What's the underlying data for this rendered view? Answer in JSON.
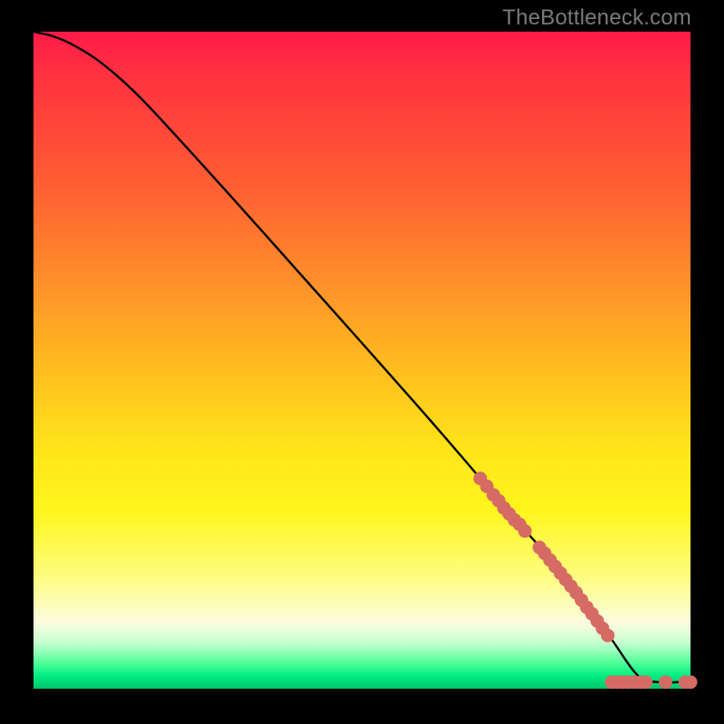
{
  "watermark": "TheBottleneck.com",
  "colors": {
    "background": "#000000",
    "curve_line": "#000000",
    "marker_fill": "#d66a64",
    "gradient_top": "#ff1b49",
    "gradient_bottom": "#00c46c"
  },
  "chart_data": {
    "type": "line",
    "title": "",
    "xlabel": "",
    "ylabel": "",
    "xlim": [
      0,
      100
    ],
    "ylim": [
      0,
      100
    ],
    "series": [
      {
        "name": "bottleneck-curve",
        "x": [
          0,
          3,
          6,
          10,
          15,
          20,
          30,
          40,
          50,
          60,
          68,
          70,
          74,
          78,
          82,
          85,
          88,
          92,
          95,
          98,
          100
        ],
        "y": [
          100,
          99.3,
          98.0,
          95.5,
          91.2,
          86.0,
          75.0,
          63.8,
          52.6,
          41.3,
          32,
          29.5,
          25,
          20.5,
          15.5,
          11.5,
          7.5,
          2,
          1,
          1,
          1
        ]
      }
    ],
    "markers": [
      {
        "x": 68.0,
        "y": 32.0
      },
      {
        "x": 69.0,
        "y": 30.8
      },
      {
        "x": 70.0,
        "y": 29.5
      },
      {
        "x": 70.8,
        "y": 28.6
      },
      {
        "x": 71.6,
        "y": 27.5
      },
      {
        "x": 72.4,
        "y": 26.6
      },
      {
        "x": 73.2,
        "y": 25.7
      },
      {
        "x": 74.0,
        "y": 25.0
      },
      {
        "x": 74.8,
        "y": 24.0
      },
      {
        "x": 77.0,
        "y": 21.5
      },
      {
        "x": 77.8,
        "y": 20.6
      },
      {
        "x": 78.6,
        "y": 19.6
      },
      {
        "x": 79.4,
        "y": 18.6
      },
      {
        "x": 80.2,
        "y": 17.6
      },
      {
        "x": 81.0,
        "y": 16.6
      },
      {
        "x": 81.8,
        "y": 15.6
      },
      {
        "x": 82.6,
        "y": 14.6
      },
      {
        "x": 83.4,
        "y": 13.5
      },
      {
        "x": 84.2,
        "y": 12.4
      },
      {
        "x": 85.0,
        "y": 11.4
      },
      {
        "x": 85.8,
        "y": 10.3
      },
      {
        "x": 86.6,
        "y": 9.2
      },
      {
        "x": 87.4,
        "y": 8.1
      },
      {
        "x": 88.0,
        "y": 1.0
      },
      {
        "x": 88.8,
        "y": 1.0
      },
      {
        "x": 89.6,
        "y": 1.0
      },
      {
        "x": 90.4,
        "y": 1.0
      },
      {
        "x": 91.4,
        "y": 1.0
      },
      {
        "x": 92.4,
        "y": 1.0
      },
      {
        "x": 93.2,
        "y": 1.0
      },
      {
        "x": 96.2,
        "y": 1.0
      },
      {
        "x": 99.2,
        "y": 1.0
      },
      {
        "x": 100.0,
        "y": 1.0
      }
    ]
  }
}
